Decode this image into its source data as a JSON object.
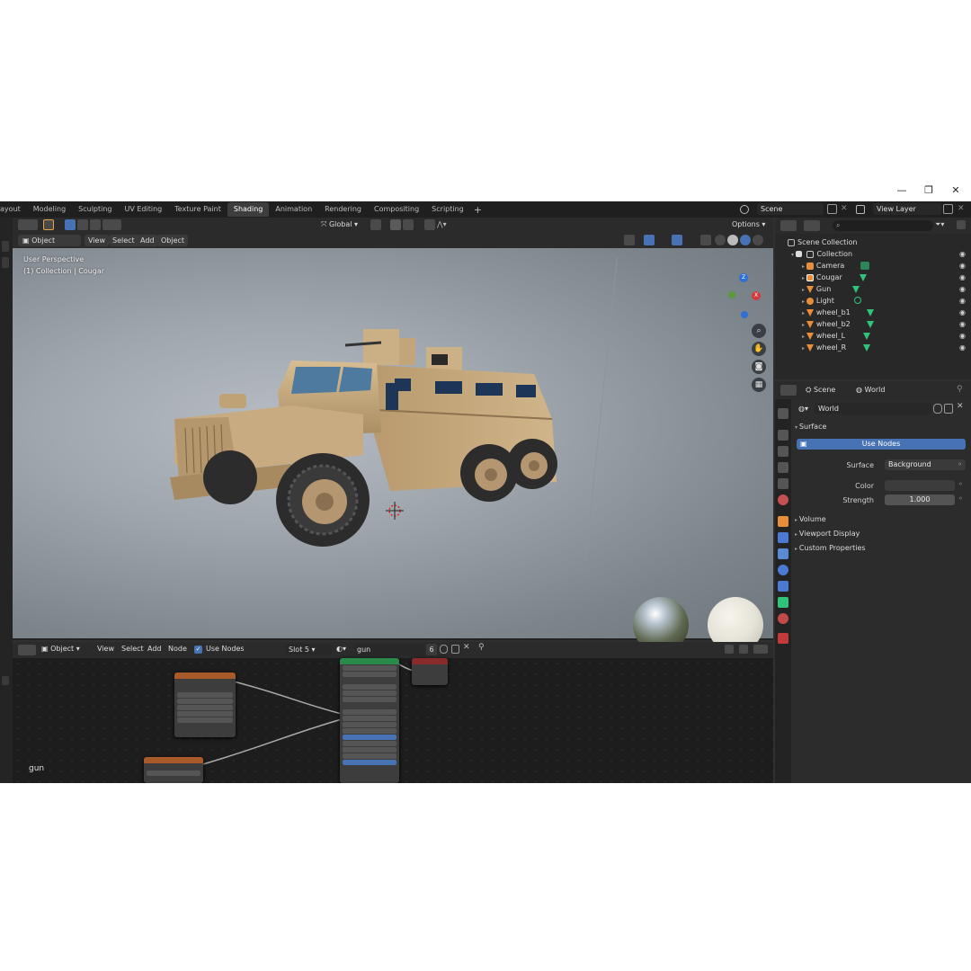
{
  "window_controls": {
    "minimize": "—",
    "maximize": "❐",
    "close": "✕"
  },
  "workspace_tabs": [
    "Layout",
    "Modeling",
    "Sculpting",
    "UV Editing",
    "Texture Paint",
    "Shading",
    "Animation",
    "Rendering",
    "Compositing",
    "Scripting"
  ],
  "workspace_tabs_visible": [
    "ayout",
    "Modeling",
    "Sculpting",
    "UV Editing",
    "Texture Paint",
    "Shading",
    "Animation",
    "Rendering",
    "Compositing",
    "Scripting"
  ],
  "active_tab": "Shading",
  "add_tab": "+",
  "scene": {
    "name": "Scene",
    "view_layer": "View Layer"
  },
  "viewport": {
    "mode": "Object Mode",
    "menus": [
      "View",
      "Select",
      "Add",
      "Object"
    ],
    "transform_orientation": "Global",
    "options": "Options",
    "overlay_line1": "User Perspective",
    "overlay_line2": "(1) Collection | Cougar",
    "gizmo": {
      "z": "Z",
      "x": "X"
    }
  },
  "node_editor": {
    "type": "Object",
    "menus": [
      "View",
      "Select",
      "Add",
      "Node"
    ],
    "use_nodes_label": "Use Nodes",
    "use_nodes_checked": true,
    "slot": "Slot 5",
    "material": "gun",
    "users": "6",
    "corner_label": "gun"
  },
  "outliner": {
    "root": "Scene Collection",
    "collection": "Collection",
    "items": [
      {
        "name": "Camera",
        "kind": "object"
      },
      {
        "name": "Cougar",
        "kind": "mesh"
      },
      {
        "name": "Gun",
        "kind": "mesh"
      },
      {
        "name": "Light",
        "kind": "object"
      },
      {
        "name": "wheel_b1",
        "kind": "mesh"
      },
      {
        "name": "wheel_b2",
        "kind": "mesh"
      },
      {
        "name": "wheel_L",
        "kind": "mesh"
      },
      {
        "name": "wheel_R",
        "kind": "mesh"
      }
    ]
  },
  "properties": {
    "breadcrumb_scene": "Scene",
    "breadcrumb_world": "World",
    "world_name": "World",
    "surface_panel": "Surface",
    "use_nodes_button": "Use Nodes",
    "surface_label": "Surface",
    "surface_value": "Background",
    "color_label": "Color",
    "strength_label": "Strength",
    "strength_value": "1.000",
    "panels": [
      "Volume",
      "Viewport Display",
      "Custom Properties"
    ]
  },
  "colors": {
    "accent": "#4772b3",
    "vehicle": "#c4a57a",
    "active_tab_bg": "#3d3d3d"
  }
}
